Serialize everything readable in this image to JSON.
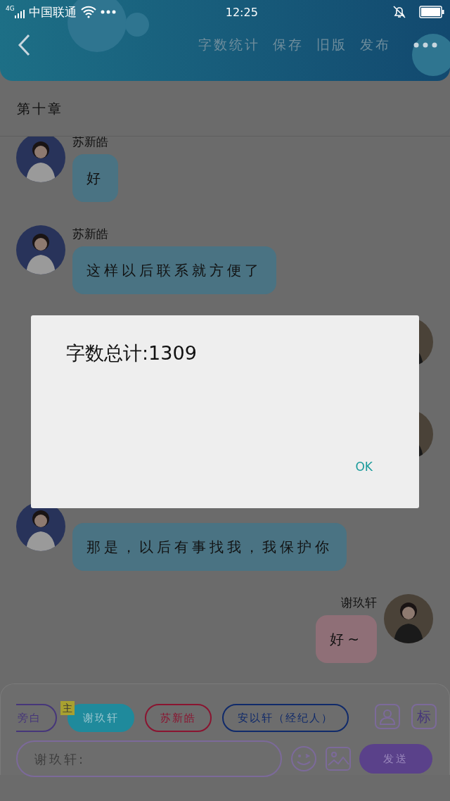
{
  "status_bar": {
    "network": "4G",
    "carrier": "中国联通",
    "time": "12:25"
  },
  "header": {
    "actions": [
      "字数统计",
      "保存",
      "旧版",
      "发布"
    ]
  },
  "chapter_title": "第十章",
  "messages": [
    {
      "kind": "incoming",
      "name": "苏新皓",
      "text": "好"
    },
    {
      "kind": "incoming",
      "name": "苏新皓",
      "text": "这样以后联系就方便了"
    },
    {
      "kind": "outgoing"
    },
    {
      "kind": "outgoing"
    },
    {
      "kind": "incoming",
      "text": "那是，以后有事找我，我保护你"
    },
    {
      "kind": "outgoing",
      "name": "谢玖轩",
      "text": "好~"
    }
  ],
  "roles": [
    {
      "label": "旁白",
      "color": "#46367a",
      "selected": false
    },
    {
      "label": "谢玖轩",
      "color": "#1f8a9c",
      "selected": true,
      "badge": "主"
    },
    {
      "label": "苏新皓",
      "color": "#8a1430",
      "selected": false
    },
    {
      "label": "安以轩（经纪人）",
      "color": "#102a6a",
      "selected": false
    }
  ],
  "tag_button": "标",
  "input": {
    "placeholder": "谢玖轩:"
  },
  "send_button": "发送",
  "dialog": {
    "message": "字数总计:1309",
    "button": "OK"
  }
}
